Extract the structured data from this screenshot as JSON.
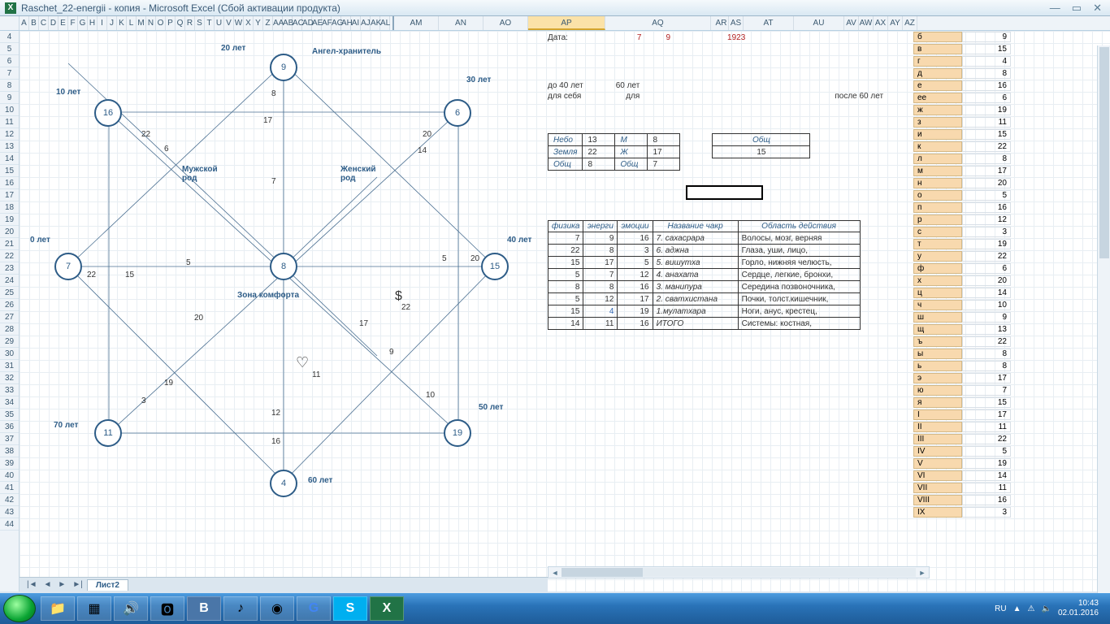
{
  "window": {
    "title": "Raschet_22-energii - копия - Microsoft Excel (Сбой активации продукта)"
  },
  "columns": [
    "A",
    "B",
    "C",
    "D",
    "E",
    "F",
    "G",
    "H",
    "I",
    "J",
    "K",
    "L",
    "M",
    "N",
    "O",
    "P",
    "Q",
    "R",
    "S",
    "T",
    "U",
    "V",
    "W",
    "X",
    "Y",
    "Z",
    "AA",
    "AB",
    "AC",
    "AD",
    "AE",
    "AF",
    "AG",
    "AH",
    "AI",
    "AJ",
    "AK",
    "AL"
  ],
  "cols2": [
    "AM",
    "AN",
    "AO",
    "AP",
    "AQ"
  ],
  "cols3": [
    "AR",
    "AS",
    "AT",
    "AU",
    "AV",
    "AW",
    "AX",
    "AY",
    "AZ"
  ],
  "selected_col": "AP",
  "rows_start": 4,
  "rows_end": 44,
  "diagram": {
    "angel": "Ангел-хранитель",
    "comfort": "Зона комфорта",
    "male": "Мужской\nрод",
    "female": "Женский\nрод",
    "ages": {
      "a0": "0 лет",
      "a10": "10 лет",
      "a20": "20 лет",
      "a30": "30 лет",
      "a40": "40 лет",
      "a50": "50 лет",
      "a60": "60 лет",
      "a70": "70 лет"
    },
    "nodes": {
      "top": "9",
      "tr": "6",
      "r": "15",
      "br": "19",
      "b": "4",
      "bl": "11",
      "l": "7",
      "tl": "16",
      "c": "8"
    },
    "innertext": {
      "n1": "8",
      "n2": "17",
      "n3": "20",
      "n4": "14",
      "n5": "22",
      "n6": "6",
      "n7": "7",
      "n8": "5",
      "n9": "20",
      "n10": "5",
      "n11": "22",
      "n12": "15",
      "n13": "17",
      "n14": "22",
      "n15": "11",
      "n16": "9",
      "n17": "10",
      "n18": "3",
      "n19": "19",
      "n20": "12",
      "n21": "16",
      "n22": "20",
      "dollar": "$",
      "heart": "♡"
    }
  },
  "date": {
    "label": "Дата:",
    "d": "7",
    "m": "9",
    "y": "1923"
  },
  "periods": {
    "p1": "до 40 лет",
    "p2": "60 лет",
    "p3": "для себя",
    "p4": "для",
    "p5": "после 60 лет"
  },
  "heaven_table": {
    "r1": {
      "a": "Небо",
      "b": "13",
      "c": "М",
      "d": "8",
      "e": "Общ"
    },
    "r2": {
      "a": "Земля",
      "b": "22",
      "c": "Ж",
      "d": "17",
      "e": "15"
    },
    "r3": {
      "a": "Общ",
      "b": "8",
      "c": "Общ",
      "d": "7",
      "e": ""
    }
  },
  "chakra": {
    "headers": {
      "h1": "физика",
      "h2": "энерги",
      "h3": "эмоции",
      "h4": "Название чакр",
      "h5": "Область действия"
    },
    "rows": [
      {
        "a": "7",
        "b": "9",
        "c": "16",
        "d": "7. сахасрара",
        "e": "Волосы, мозг, верняя"
      },
      {
        "a": "22",
        "b": "8",
        "c": "3",
        "d": "6. аджна",
        "e": "Глаза, уши, лицо,"
      },
      {
        "a": "15",
        "b": "17",
        "c": "5",
        "d": "5. вишутха",
        "e": "Горло, нижняя челюсть,"
      },
      {
        "a": "5",
        "b": "7",
        "c": "12",
        "d": "4. анахата",
        "e": "Сердце, легкие, бронхи,"
      },
      {
        "a": "8",
        "b": "8",
        "c": "16",
        "d": "3. манипура",
        "e": "Середина позвоночника,"
      },
      {
        "a": "5",
        "b": "12",
        "c": "17",
        "d": "2. сватхистана",
        "e": "Почки, толст.кишечник,"
      },
      {
        "a": "15",
        "b": "4",
        "c": "19",
        "d": "1.мулатхара",
        "e": "Ноги, анус, крестец,"
      },
      {
        "a": "14",
        "b": "11",
        "c": "16",
        "d": "ИТОГО",
        "e": "Системы: костная,"
      }
    ]
  },
  "letter_table": [
    {
      "l": "б",
      "v": "9"
    },
    {
      "l": "в",
      "v": "15"
    },
    {
      "l": "г",
      "v": "4"
    },
    {
      "l": "д",
      "v": "8"
    },
    {
      "l": "е",
      "v": "16"
    },
    {
      "l": "ее",
      "v": "6"
    },
    {
      "l": "ж",
      "v": "19"
    },
    {
      "l": "з",
      "v": "11"
    },
    {
      "l": "и",
      "v": "15"
    },
    {
      "l": "к",
      "v": "22"
    },
    {
      "l": "л",
      "v": "8"
    },
    {
      "l": "м",
      "v": "17"
    },
    {
      "l": "н",
      "v": "20"
    },
    {
      "l": "о",
      "v": "5"
    },
    {
      "l": "п",
      "v": "16"
    },
    {
      "l": "р",
      "v": "12"
    },
    {
      "l": "с",
      "v": "3"
    },
    {
      "l": "т",
      "v": "19"
    },
    {
      "l": "у",
      "v": "22"
    },
    {
      "l": "ф",
      "v": "6"
    },
    {
      "l": "х",
      "v": "20"
    },
    {
      "l": "ц",
      "v": "14"
    },
    {
      "l": "ч",
      "v": "10"
    },
    {
      "l": "ш",
      "v": "9"
    },
    {
      "l": "щ",
      "v": "13"
    },
    {
      "l": "ъ",
      "v": "22"
    },
    {
      "l": "ы",
      "v": "8"
    },
    {
      "l": "ь",
      "v": "8"
    },
    {
      "l": "э",
      "v": "17"
    },
    {
      "l": "ю",
      "v": "7"
    },
    {
      "l": "я",
      "v": "15"
    },
    {
      "l": "I",
      "v": "17"
    },
    {
      "l": "II",
      "v": "11"
    },
    {
      "l": "III",
      "v": "22"
    },
    {
      "l": "IV",
      "v": "5"
    },
    {
      "l": "V",
      "v": "19"
    },
    {
      "l": "VI",
      "v": "14"
    },
    {
      "l": "VII",
      "v": "11"
    },
    {
      "l": "VIII",
      "v": "16"
    },
    {
      "l": "IX",
      "v": "3"
    }
  ],
  "sheet_tab": "Лист2",
  "tray": {
    "lang": "RU",
    "time": "10:43",
    "date": "02.01.2016"
  }
}
